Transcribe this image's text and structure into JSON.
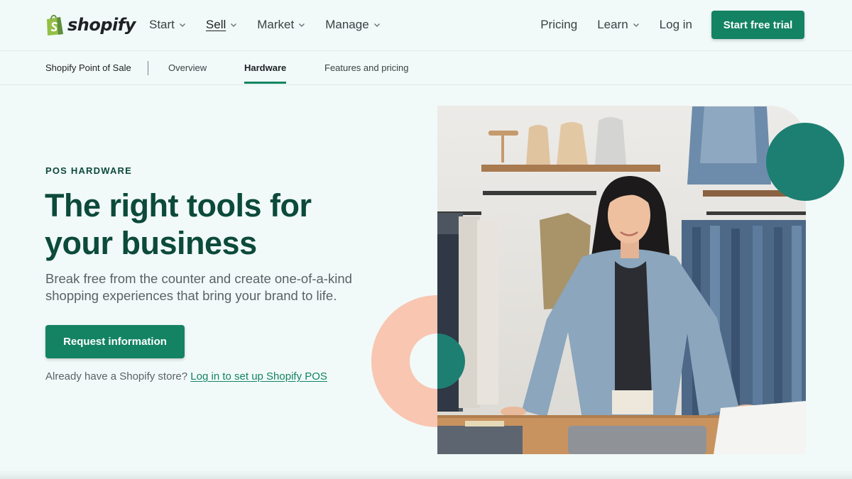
{
  "brand": {
    "wordmark": "shopify",
    "logo_icon": "shopping-bag-icon",
    "color": "#138363"
  },
  "topnav": {
    "left_items": [
      {
        "label": "Start",
        "dropdown": true
      },
      {
        "label": "Sell",
        "dropdown": true,
        "active": true
      },
      {
        "label": "Market",
        "dropdown": true
      },
      {
        "label": "Manage",
        "dropdown": true
      }
    ],
    "right_items": [
      {
        "label": "Pricing",
        "dropdown": false
      },
      {
        "label": "Learn",
        "dropdown": true
      },
      {
        "label": "Log in",
        "dropdown": false
      }
    ],
    "cta_label": "Start free trial"
  },
  "subnav": {
    "title": "Shopify Point of Sale",
    "links": [
      "Overview",
      "Hardware",
      "Features and pricing"
    ],
    "active": "Hardware"
  },
  "hero": {
    "eyebrow": "POS HARDWARE",
    "headline": "The right tools for your business",
    "subtext": "Break free from the counter and create one-of-a-kind shopping experiences that bring your brand to life.",
    "cta_label": "Request information",
    "already_text": "Already have a Shopify store?",
    "already_link": "Log in to set up Shopify POS"
  },
  "colors": {
    "accent": "#138363",
    "heading": "#0c4a39",
    "background": "#f1faf8",
    "peach": "#f9c6b2",
    "teal_shape": "#1d7f72"
  }
}
